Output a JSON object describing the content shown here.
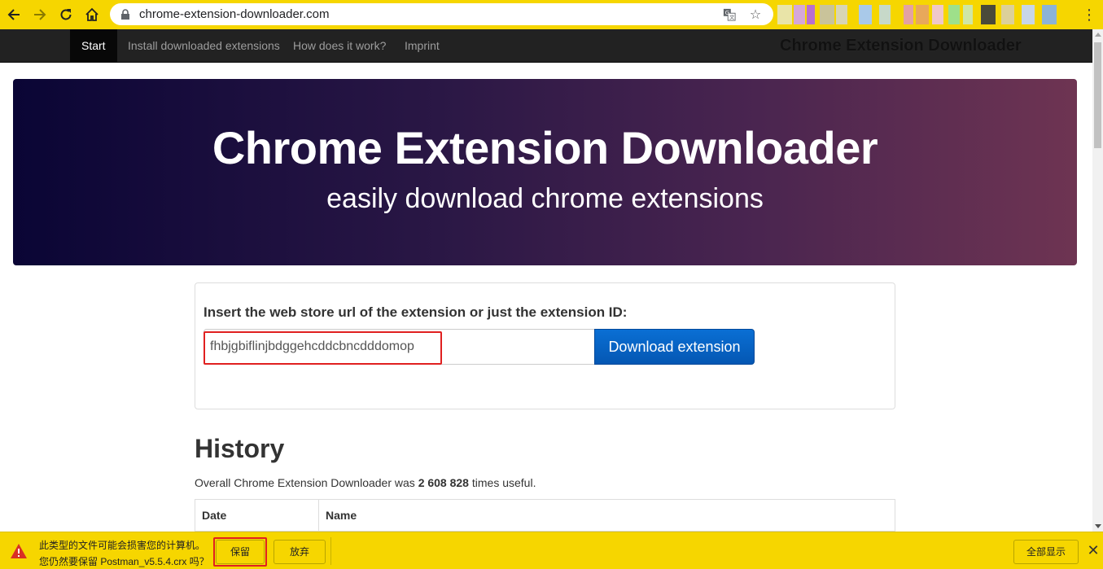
{
  "browser": {
    "url": "chrome-extension-downloader.com",
    "icons": {
      "back": "back-arrow-icon",
      "forward": "forward-arrow-icon",
      "reload": "reload-icon",
      "home": "home-icon",
      "lock": "lock-icon",
      "translate": "translate-icon",
      "bookmark": "star-icon",
      "menu": "kebab-menu-icon"
    },
    "accent_color": "#f6d600"
  },
  "navbar": {
    "items": [
      {
        "label": "Start",
        "active": true
      },
      {
        "label": "Install downloaded extensions",
        "active": false
      },
      {
        "label": "How does it work?",
        "active": false
      },
      {
        "label": "Imprint",
        "active": false
      }
    ],
    "brand": "Chrome Extension Downloader"
  },
  "hero": {
    "title": "Chrome Extension Downloader",
    "subtitle": "easily download chrome extensions"
  },
  "form": {
    "label": "Insert the web store url of the extension or just the extension ID:",
    "input_value": "fhbjgbiflinjbdggehcddcbncdddomop",
    "button_label": "Download extension",
    "button_color": "#0a6fd4"
  },
  "history": {
    "title": "History",
    "text_prefix": "Overall Chrome Extension Downloader was ",
    "count": "2 608 828",
    "text_suffix": " times useful.",
    "columns": [
      "Date",
      "Name"
    ]
  },
  "download_bar": {
    "message_line1": "此类型的文件可能会损害您的计算机。",
    "message_line2": "您仍然要保留 Postman_v5.5.4.crx 吗？",
    "keep_label": "保留",
    "discard_label": "放弃",
    "show_all_label": "全部显示",
    "close_label": "✕",
    "warning_color": "#d93025"
  }
}
